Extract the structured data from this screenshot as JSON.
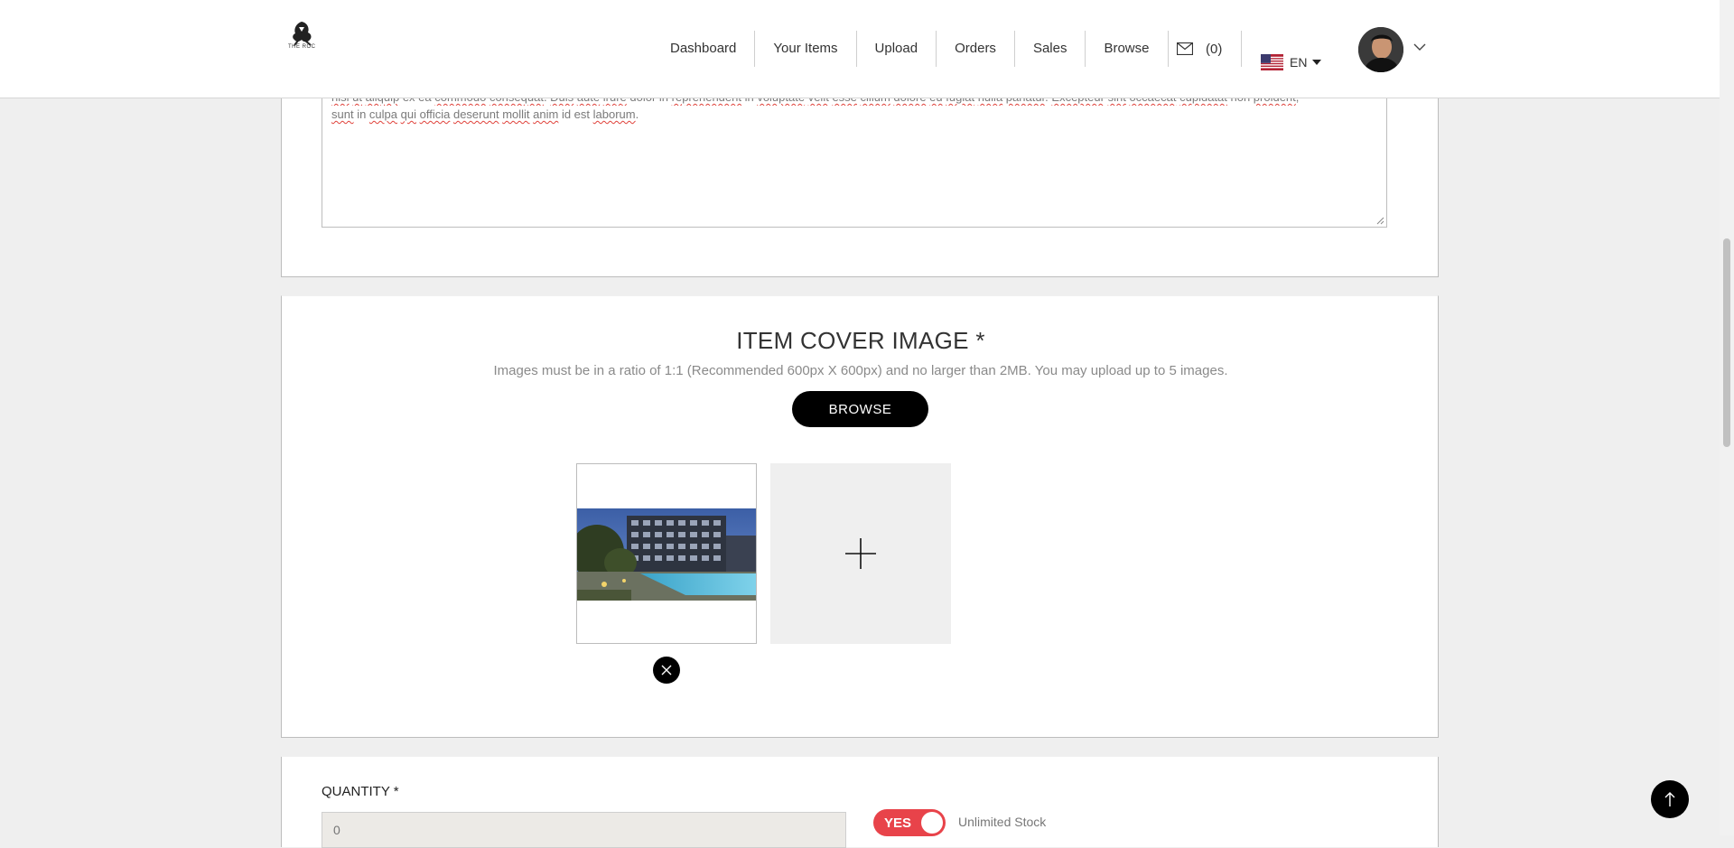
{
  "header": {
    "logo_text": "THE ROC",
    "nav": [
      "Dashboard",
      "Your Items",
      "Upload",
      "Orders",
      "Sales",
      "Browse"
    ],
    "mail_count": "(0)",
    "language": "EN"
  },
  "description": {
    "line1_words": [
      {
        "t": "nisi",
        "s": true
      },
      {
        "t": " ",
        "s": false
      },
      {
        "t": "ut",
        "s": true
      },
      {
        "t": " ",
        "s": false
      },
      {
        "t": "aliquip",
        "s": true
      },
      {
        "t": " ex ea ",
        "s": false
      },
      {
        "t": "commodo",
        "s": true
      },
      {
        "t": " ",
        "s": false
      },
      {
        "t": "consequat",
        "s": true
      },
      {
        "t": ". ",
        "s": false
      },
      {
        "t": "Duis",
        "s": true
      },
      {
        "t": " ",
        "s": false
      },
      {
        "t": "aute",
        "s": true
      },
      {
        "t": " ",
        "s": false
      },
      {
        "t": "irure",
        "s": true
      },
      {
        "t": " dolor in ",
        "s": false
      },
      {
        "t": "reprehenderit",
        "s": true
      },
      {
        "t": " in ",
        "s": false
      },
      {
        "t": "voluptate",
        "s": true
      },
      {
        "t": " ",
        "s": false
      },
      {
        "t": "velit",
        "s": true
      },
      {
        "t": " ",
        "s": false
      },
      {
        "t": "esse",
        "s": true
      },
      {
        "t": " ",
        "s": false
      },
      {
        "t": "cillum",
        "s": true
      },
      {
        "t": " ",
        "s": false
      },
      {
        "t": "dolore",
        "s": true
      },
      {
        "t": " ",
        "s": false
      },
      {
        "t": "eu",
        "s": true
      },
      {
        "t": " ",
        "s": false
      },
      {
        "t": "fugiat",
        "s": true
      },
      {
        "t": " ",
        "s": false
      },
      {
        "t": "nulla",
        "s": true
      },
      {
        "t": " ",
        "s": false
      },
      {
        "t": "pariatur",
        "s": true
      },
      {
        "t": ". ",
        "s": false
      },
      {
        "t": "Excepteur",
        "s": true
      },
      {
        "t": " ",
        "s": false
      },
      {
        "t": "sint",
        "s": true
      },
      {
        "t": " ",
        "s": false
      },
      {
        "t": "occaecat",
        "s": true
      },
      {
        "t": " ",
        "s": false
      },
      {
        "t": "cupidatat",
        "s": true
      },
      {
        "t": " non ",
        "s": false
      },
      {
        "t": "proident",
        "s": true
      },
      {
        "t": ",",
        "s": false
      }
    ],
    "line2_words": [
      {
        "t": "sunt",
        "s": true
      },
      {
        "t": " in ",
        "s": false
      },
      {
        "t": "culpa",
        "s": true
      },
      {
        "t": " ",
        "s": false
      },
      {
        "t": "qui",
        "s": true
      },
      {
        "t": " ",
        "s": false
      },
      {
        "t": "officia",
        "s": true
      },
      {
        "t": " ",
        "s": false
      },
      {
        "t": "deserunt",
        "s": true
      },
      {
        "t": " ",
        "s": false
      },
      {
        "t": "mollit",
        "s": true
      },
      {
        "t": " ",
        "s": false
      },
      {
        "t": "anim",
        "s": true
      },
      {
        "t": " id est ",
        "s": false
      },
      {
        "t": "laborum",
        "s": true
      },
      {
        "t": ".",
        "s": false
      }
    ]
  },
  "cover": {
    "title": "ITEM COVER IMAGE *",
    "note": "Images must be in a ratio of 1:1 (Recommended 600px X 600px) and no larger than 2MB. You may upload up to 5 images.",
    "browse_label": "BROWSE"
  },
  "quantity": {
    "label": "QUANTITY *",
    "placeholder": "0",
    "toggle_label": "YES",
    "toggle_caption": "Unlimited Stock"
  },
  "colors": {
    "accent_red": "#e8434a",
    "button_black": "#000000"
  },
  "icons": [
    "logo-icon",
    "mail-icon",
    "us-flag-icon",
    "caret-down-icon",
    "chevron-down-icon",
    "plus-icon",
    "close-icon",
    "arrow-up-icon"
  ]
}
